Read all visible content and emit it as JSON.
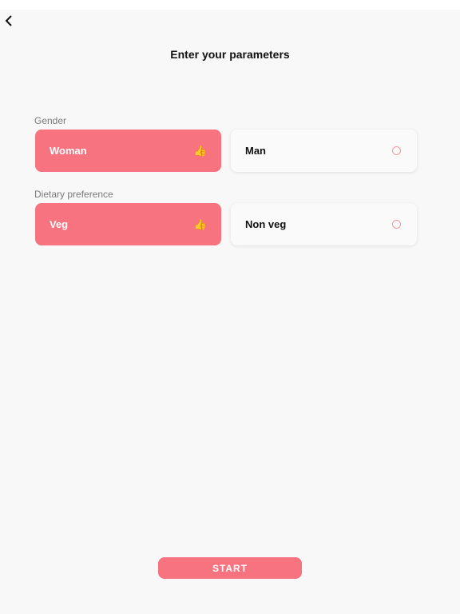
{
  "header": {
    "back_icon": "chevron-left-icon",
    "title": "Enter your parameters"
  },
  "gender": {
    "label": "Gender",
    "options": [
      {
        "label": "Woman",
        "selected": true,
        "icon": "thumbs-up-icon",
        "glyph": "👍"
      },
      {
        "label": "Man",
        "selected": false,
        "icon": "radio-empty-icon"
      }
    ]
  },
  "diet": {
    "label": "Dietary preference",
    "options": [
      {
        "label": "Veg",
        "selected": true,
        "icon": "thumbs-up-icon",
        "glyph": "👍"
      },
      {
        "label": "Non veg",
        "selected": false,
        "icon": "radio-empty-icon"
      }
    ]
  },
  "start_label": "START",
  "colors": {
    "accent": "#f7737f",
    "background": "#f8f8f8",
    "radio": "#f29aa2"
  }
}
